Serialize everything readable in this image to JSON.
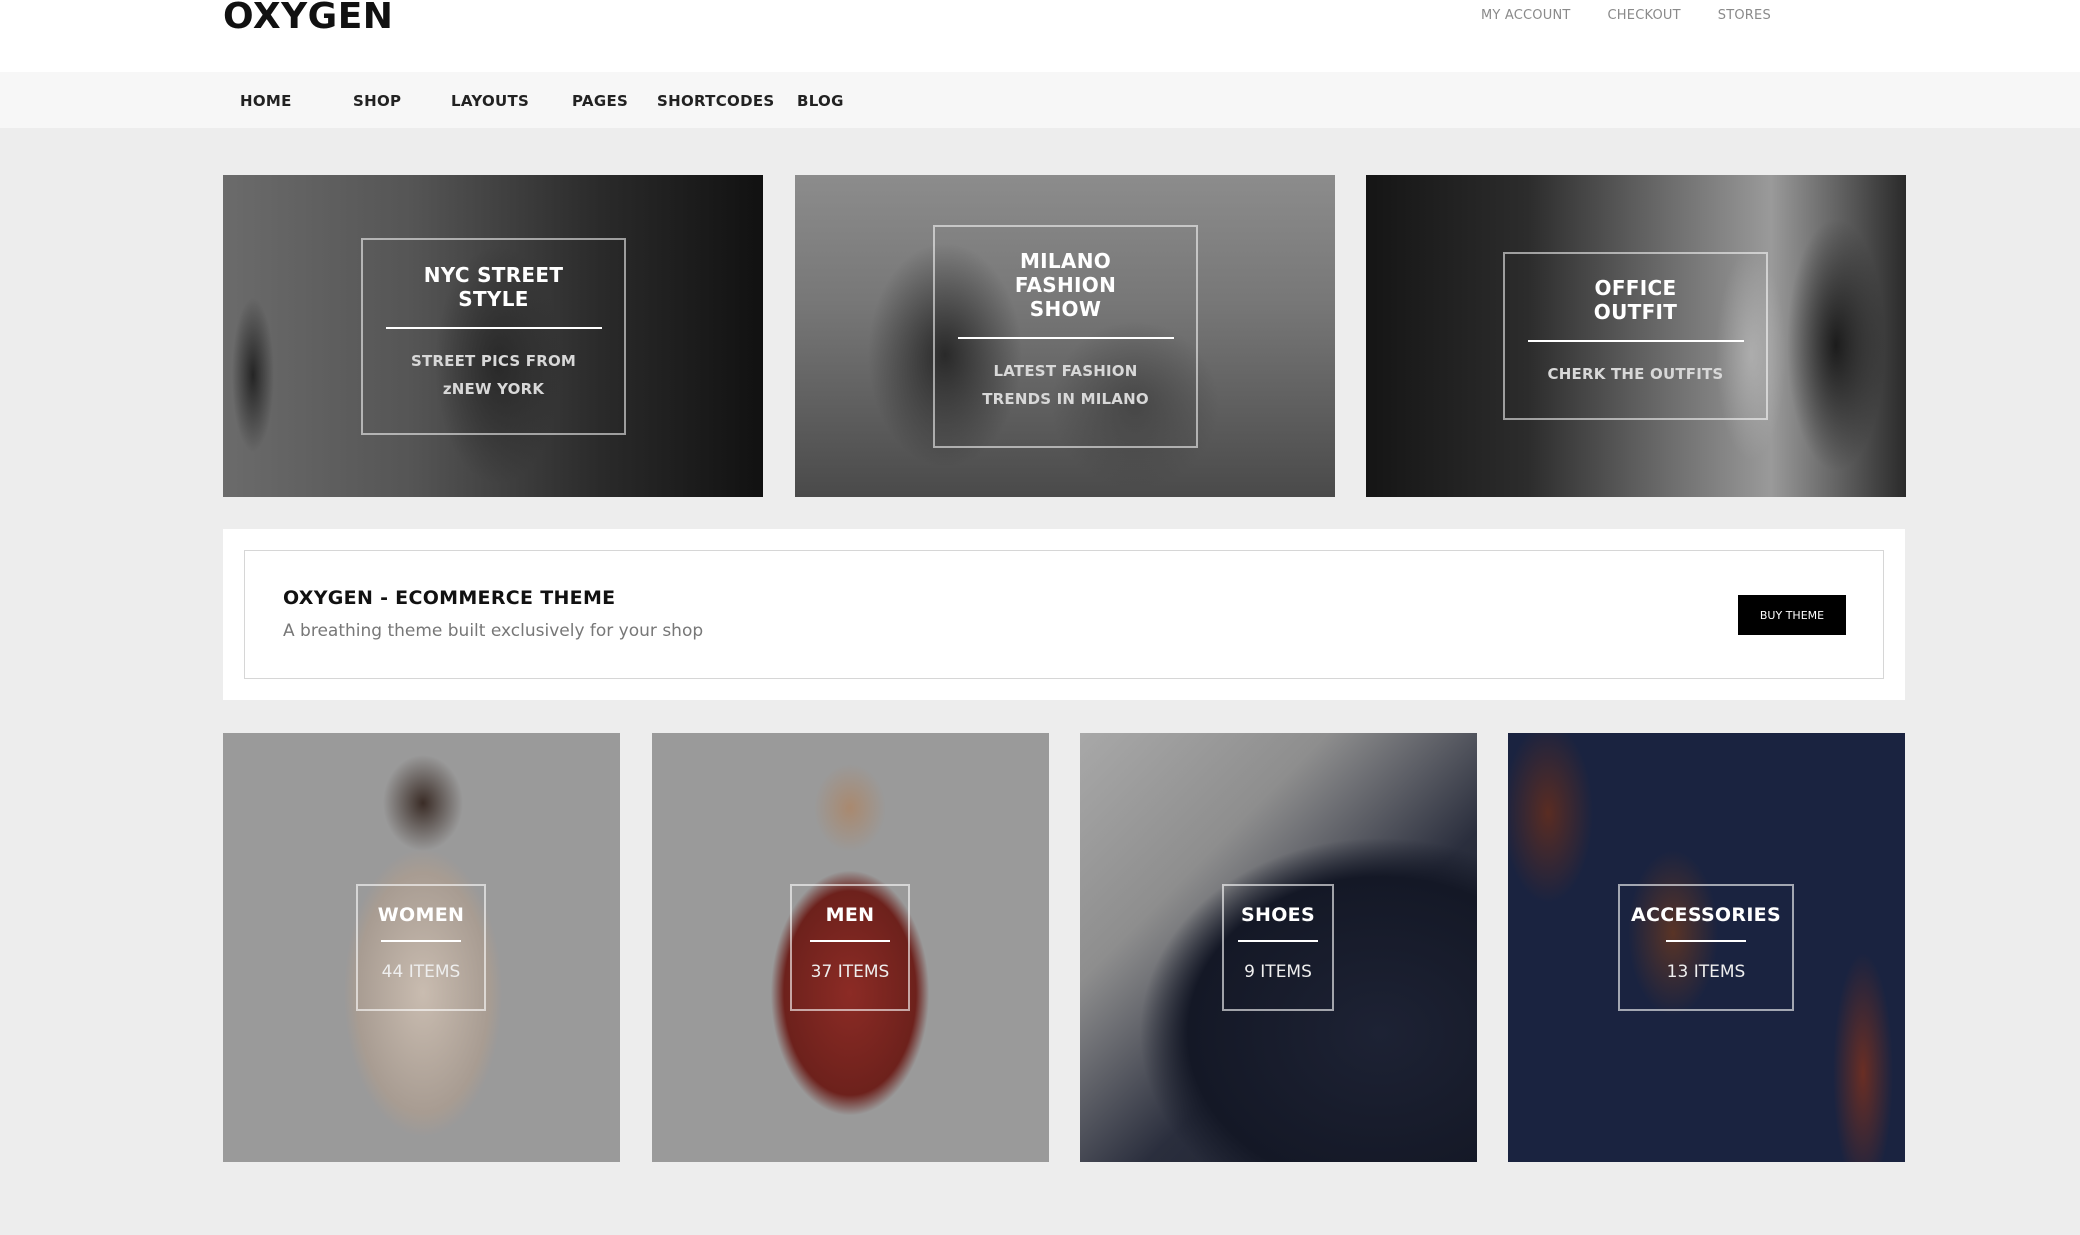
{
  "header": {
    "logo": "OXYGEN",
    "top_links": [
      "MY ACCOUNT",
      "CHECKOUT",
      "STORES"
    ]
  },
  "nav": {
    "items": [
      "HOME",
      "SHOP",
      "LAYOUTS",
      "PAGES",
      "SHORTCODES",
      "BLOG"
    ]
  },
  "banners": [
    {
      "title_line1": "NYC STREET",
      "title_line2": "STYLE",
      "sub_line1": "STREET PICS FROM",
      "sub_line2": "zNEW YORK"
    },
    {
      "title_line1": "MILANO",
      "title_line2": "FASHION",
      "title_line3": "SHOW",
      "sub_line1": "LATEST FASHION",
      "sub_line2": "TRENDS IN MILANO"
    },
    {
      "title_line1": "OFFICE",
      "title_line2": "OUTFIT",
      "sub_line1": "CHERK THE OUTFITS"
    }
  ],
  "promo": {
    "title": "OXYGEN - ECOMMERCE THEME",
    "subtitle": "A breathing theme built exclusively for your shop",
    "button_label": "BUY THEME"
  },
  "categories": [
    {
      "name": "WOMEN",
      "count": "44 ITEMS"
    },
    {
      "name": "MEN",
      "count": "37 ITEMS"
    },
    {
      "name": "SHOES",
      "count": "9 ITEMS"
    },
    {
      "name": "ACCESSORIES",
      "count": "13 ITEMS"
    }
  ],
  "colors": {
    "page_bg": "#ededed",
    "header_bg": "#ffffff",
    "nav_bg": "#f7f7f7",
    "button_bg": "#000000",
    "text_dark": "#111111",
    "text_muted": "#8a8a8a"
  }
}
